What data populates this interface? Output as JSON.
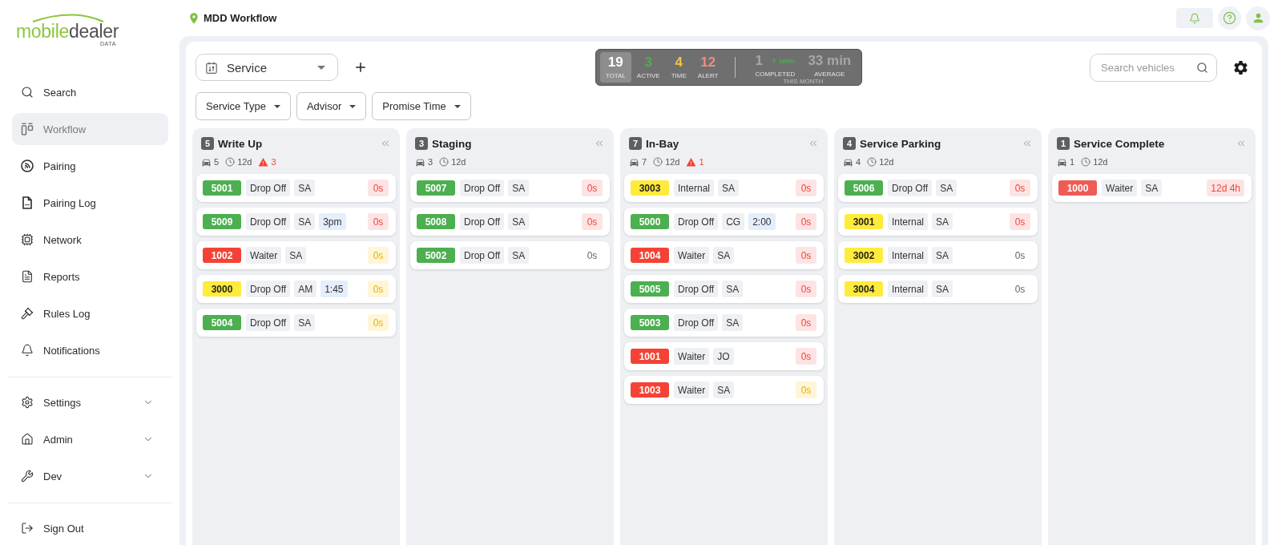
{
  "sidebar": {
    "logo": {
      "wordmark": [
        "mobile",
        "dealer"
      ],
      "tagline": "DATA"
    },
    "sections": [
      {
        "items": [
          {
            "label": "Search",
            "selected": false
          },
          {
            "label": "Workflow",
            "selected": true
          },
          {
            "label": "Pairing",
            "selected": false
          },
          {
            "label": "Pairing Log",
            "selected": false
          },
          {
            "label": "Network",
            "selected": false
          },
          {
            "label": "Reports",
            "selected": false
          },
          {
            "label": "Rules Log",
            "selected": false
          },
          {
            "label": "Notifications",
            "selected": false
          }
        ]
      },
      {
        "items": [
          {
            "label": "Settings",
            "selected": false,
            "expanded": false
          },
          {
            "label": "Admin",
            "selected": false,
            "expanded": false
          },
          {
            "label": "Dev",
            "selected": false,
            "expanded": false
          }
        ]
      },
      {
        "items": [
          {
            "label": "Sign Out",
            "selected": false
          }
        ]
      }
    ]
  },
  "topbar": {
    "title": "MDD Workflow"
  },
  "toolbar": {
    "view_select": {
      "value": "Service"
    },
    "stats": {
      "items": [
        {
          "value": "19",
          "label": "TOTAL",
          "color": "#ffffff",
          "selected": true
        },
        {
          "value": "3",
          "label": "ACTIVE",
          "color": "#4caf50",
          "selected": false
        },
        {
          "value": "4",
          "label": "TIME",
          "color": "#f5c242",
          "selected": false
        },
        {
          "value": "12",
          "label": "ALERT",
          "color": "#f28b82",
          "selected": false
        }
      ],
      "summary": [
        {
          "value": "1",
          "change": "100%",
          "label": "COMPLETED"
        },
        {
          "value": "33 min",
          "label": "AVERAGE"
        }
      ],
      "period": "THIS MONTH"
    },
    "search": {
      "placeholder": "Search vehicles"
    }
  },
  "filters": [
    {
      "label": "Service Type"
    },
    {
      "label": "Advisor"
    },
    {
      "label": "Promise Time"
    }
  ],
  "columns": [
    {
      "count": "5",
      "title": "Write Up",
      "vehicles": "5",
      "age": "12d",
      "alerts": "3",
      "cards": [
        {
          "number": "5001",
          "color": "#4caf50",
          "chips": [
            {
              "text": "Drop Off",
              "kind": "type"
            },
            {
              "text": "SA",
              "kind": "advisor"
            }
          ],
          "timer": {
            "text": "0s",
            "kind": "alert"
          }
        },
        {
          "number": "5009",
          "color": "#4caf50",
          "chips": [
            {
              "text": "Drop Off",
              "kind": "type"
            },
            {
              "text": "SA",
              "kind": "advisor"
            },
            {
              "text": "3pm",
              "kind": "promise"
            }
          ],
          "timer": {
            "text": "0s",
            "kind": "alert"
          }
        },
        {
          "number": "1002",
          "color": "#f44336",
          "chips": [
            {
              "text": "Waiter",
              "kind": "type"
            },
            {
              "text": "SA",
              "kind": "advisor"
            }
          ],
          "timer": {
            "text": "0s",
            "kind": "warning"
          }
        },
        {
          "number": "3000",
          "color": "#ffeb3b",
          "chips": [
            {
              "text": "Drop Off",
              "kind": "type"
            },
            {
              "text": "AM",
              "kind": "advisor"
            },
            {
              "text": "1:45",
              "kind": "promise"
            }
          ],
          "timer": {
            "text": "0s",
            "kind": "warning"
          }
        },
        {
          "number": "5004",
          "color": "#4caf50",
          "chips": [
            {
              "text": "Drop Off",
              "kind": "type"
            },
            {
              "text": "SA",
              "kind": "advisor"
            }
          ],
          "timer": {
            "text": "0s",
            "kind": "warning"
          }
        }
      ]
    },
    {
      "count": "3",
      "title": "Staging",
      "vehicles": "3",
      "age": "12d",
      "cards": [
        {
          "number": "5007",
          "color": "#4caf50",
          "chips": [
            {
              "text": "Drop Off",
              "kind": "type"
            },
            {
              "text": "SA",
              "kind": "advisor"
            }
          ],
          "timer": {
            "text": "0s",
            "kind": "alert"
          }
        },
        {
          "number": "5008",
          "color": "#4caf50",
          "chips": [
            {
              "text": "Drop Off",
              "kind": "type"
            },
            {
              "text": "SA",
              "kind": "advisor"
            }
          ],
          "timer": {
            "text": "0s",
            "kind": "alert"
          }
        },
        {
          "number": "5002",
          "color": "#4caf50",
          "chips": [
            {
              "text": "Drop Off",
              "kind": "type"
            },
            {
              "text": "SA",
              "kind": "advisor"
            }
          ],
          "timer": {
            "text": "0s",
            "kind": "normal"
          }
        }
      ]
    },
    {
      "count": "7",
      "title": "In-Bay",
      "vehicles": "7",
      "age": "12d",
      "alerts": "1",
      "cards": [
        {
          "number": "3003",
          "color": "#ffeb3b",
          "chips": [
            {
              "text": "Internal",
              "kind": "type"
            },
            {
              "text": "SA",
              "kind": "advisor"
            }
          ],
          "timer": {
            "text": "0s",
            "kind": "alert"
          }
        },
        {
          "number": "5000",
          "color": "#4caf50",
          "chips": [
            {
              "text": "Drop Off",
              "kind": "type"
            },
            {
              "text": "CG",
              "kind": "advisor"
            },
            {
              "text": "2:00",
              "kind": "promise"
            }
          ],
          "timer": {
            "text": "0s",
            "kind": "alert"
          }
        },
        {
          "number": "1004",
          "color": "#f44336",
          "chips": [
            {
              "text": "Waiter",
              "kind": "type"
            },
            {
              "text": "SA",
              "kind": "advisor"
            }
          ],
          "timer": {
            "text": "0s",
            "kind": "alert"
          }
        },
        {
          "number": "5005",
          "color": "#4caf50",
          "chips": [
            {
              "text": "Drop Off",
              "kind": "type"
            },
            {
              "text": "SA",
              "kind": "advisor"
            }
          ],
          "timer": {
            "text": "0s",
            "kind": "alert"
          }
        },
        {
          "number": "5003",
          "color": "#4caf50",
          "chips": [
            {
              "text": "Drop Off",
              "kind": "type"
            },
            {
              "text": "SA",
              "kind": "advisor"
            }
          ],
          "timer": {
            "text": "0s",
            "kind": "alert"
          }
        },
        {
          "number": "1001",
          "color": "#f44336",
          "chips": [
            {
              "text": "Waiter",
              "kind": "type"
            },
            {
              "text": "JO",
              "kind": "advisor"
            }
          ],
          "timer": {
            "text": "0s",
            "kind": "alert"
          }
        },
        {
          "number": "1003",
          "color": "#f44336",
          "chips": [
            {
              "text": "Waiter",
              "kind": "type"
            },
            {
              "text": "SA",
              "kind": "advisor"
            }
          ],
          "timer": {
            "text": "0s",
            "kind": "warning"
          }
        }
      ]
    },
    {
      "count": "4",
      "title": "Service Parking",
      "vehicles": "4",
      "age": "12d",
      "cards": [
        {
          "number": "5006",
          "color": "#4caf50",
          "chips": [
            {
              "text": "Drop Off",
              "kind": "type"
            },
            {
              "text": "SA",
              "kind": "advisor"
            }
          ],
          "timer": {
            "text": "0s",
            "kind": "alert"
          }
        },
        {
          "number": "3001",
          "color": "#ffeb3b",
          "chips": [
            {
              "text": "Internal",
              "kind": "type"
            },
            {
              "text": "SA",
              "kind": "advisor"
            }
          ],
          "timer": {
            "text": "0s",
            "kind": "alert"
          }
        },
        {
          "number": "3002",
          "color": "#ffeb3b",
          "chips": [
            {
              "text": "Internal",
              "kind": "type"
            },
            {
              "text": "SA",
              "kind": "advisor"
            }
          ],
          "timer": {
            "text": "0s",
            "kind": "normal"
          }
        },
        {
          "number": "3004",
          "color": "#ffeb3b",
          "chips": [
            {
              "text": "Internal",
              "kind": "type"
            },
            {
              "text": "SA",
              "kind": "advisor"
            }
          ],
          "timer": {
            "text": "0s",
            "kind": "normal"
          }
        }
      ]
    },
    {
      "count": "1",
      "title": "Service Complete",
      "vehicles": "1",
      "age": "12d",
      "cards": [
        {
          "number": "1000",
          "color": "#ef5b55",
          "chips": [
            {
              "text": "Waiter",
              "kind": "type"
            },
            {
              "text": "SA",
              "kind": "advisor"
            }
          ],
          "timer": {
            "text": "12d 4h",
            "kind": "alert"
          }
        }
      ]
    }
  ]
}
